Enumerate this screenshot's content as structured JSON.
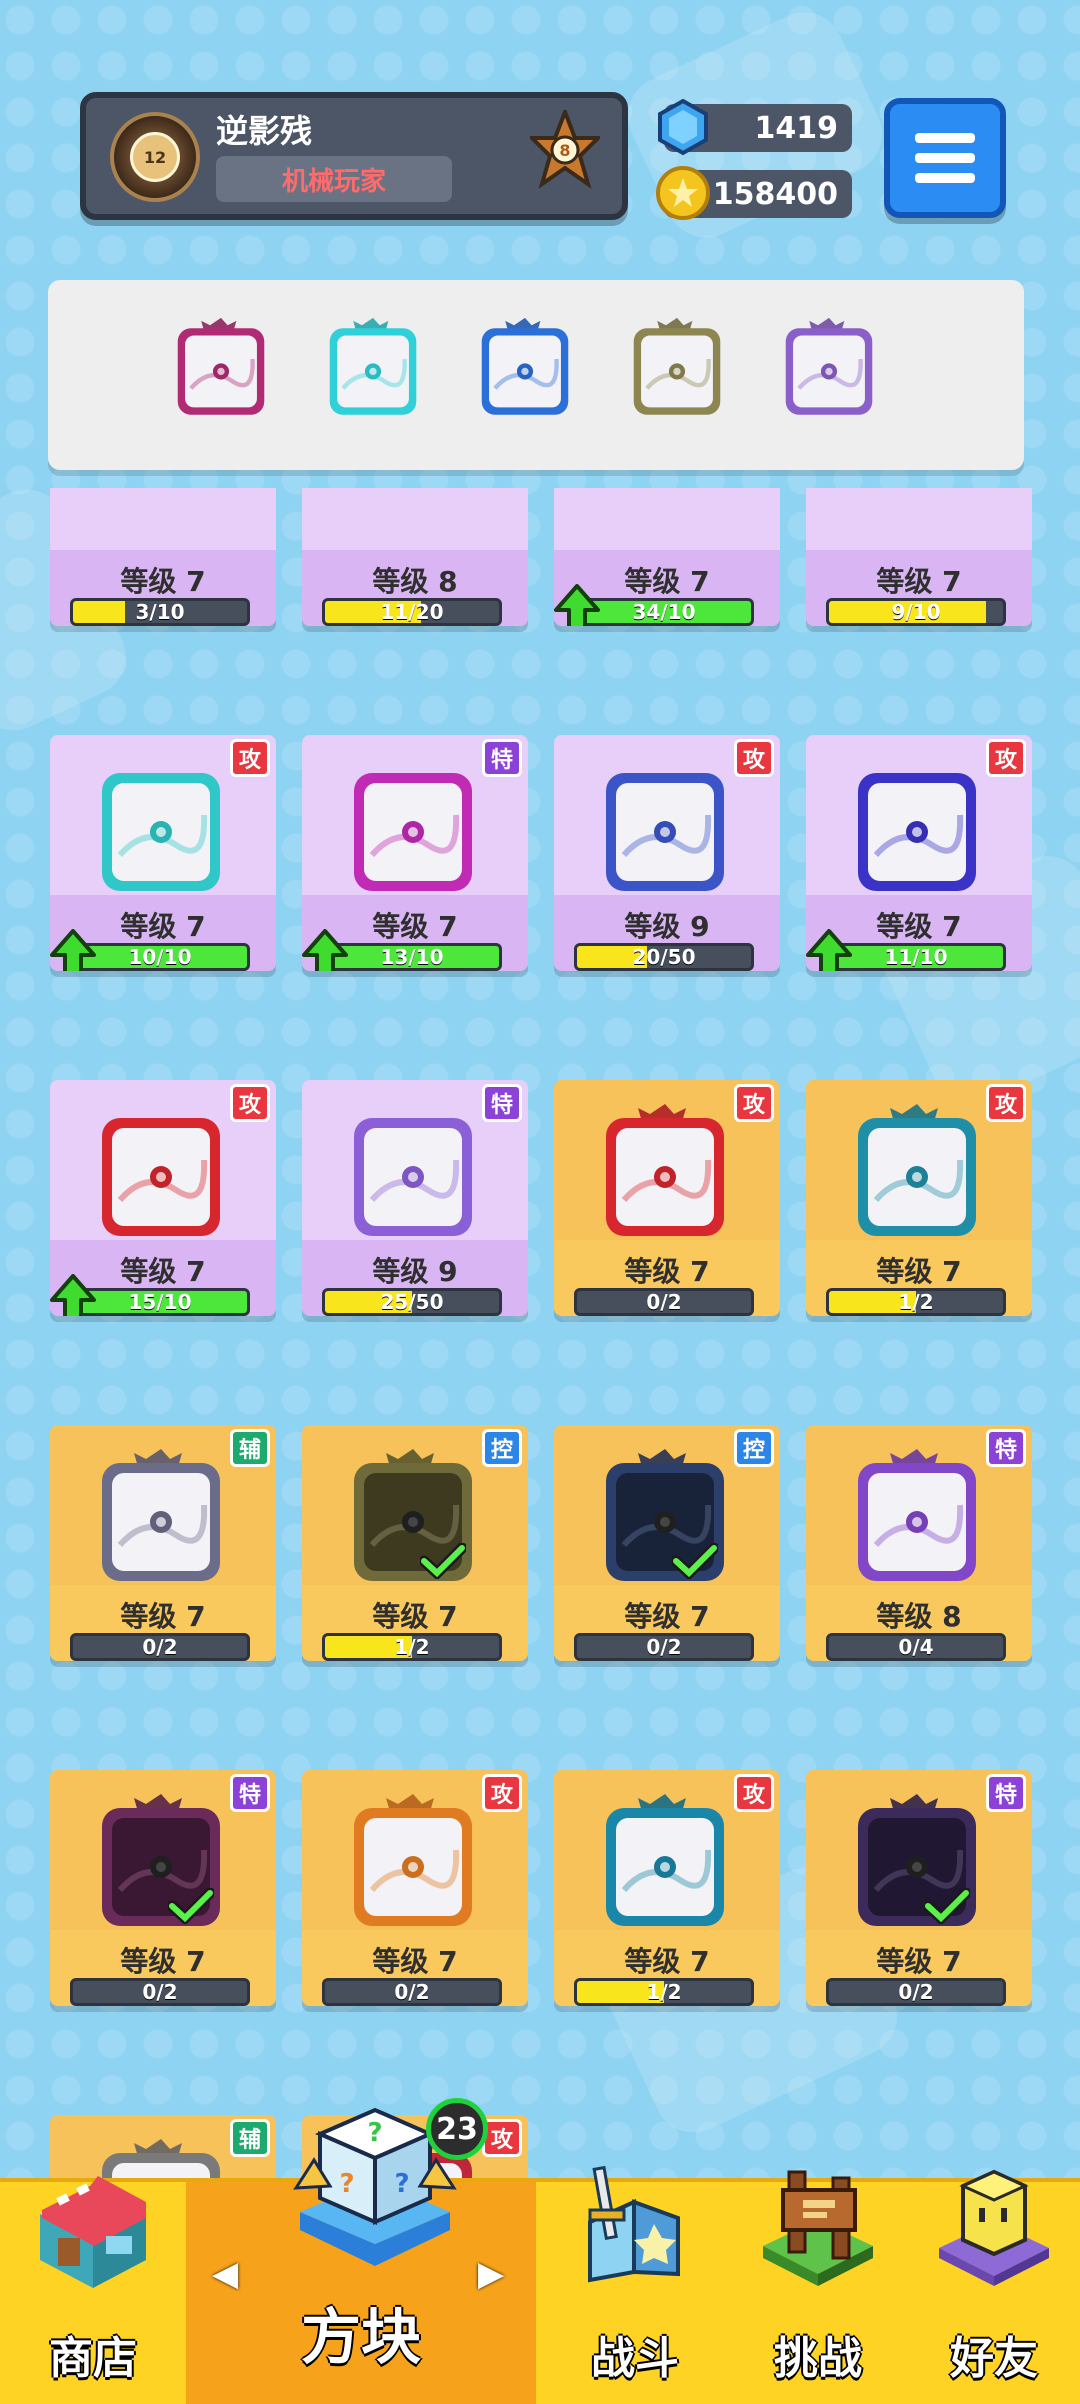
{
  "player": {
    "name": "逆影残",
    "title": "机械玩家",
    "avatar_level": "12",
    "rank": "8"
  },
  "currency": {
    "gems": "1419",
    "coins": "158400"
  },
  "colors": {
    "background": "#8fd3f2",
    "card_purple": "#e3c8f7",
    "card_gold": "#f7c25a",
    "nav_bar": "#ffd324",
    "nav_active": "#f7a21b",
    "progress_yellow": "#f8e51b",
    "progress_green": "#4de73b",
    "badge_attack": "#e8373f",
    "badge_special": "#8c42d6",
    "badge_support": "#1eaa6e",
    "badge_control": "#2b86e8",
    "menu_button": "#2b8cf4"
  },
  "deck": [
    {
      "icon": "crossbow-dice-icon",
      "color": "#b02b73"
    },
    {
      "icon": "wind-dice-icon",
      "color": "#2fd0d8"
    },
    {
      "icon": "ice-dice-icon",
      "color": "#2b6fd8"
    },
    {
      "icon": "shield-dice-icon",
      "color": "#8d8650"
    },
    {
      "icon": "void-dice-icon",
      "color": "#8b5fc9"
    }
  ],
  "cards": [
    {
      "tier": "purple",
      "level": "等级 7",
      "progress": "3/10",
      "ratio": 0.3,
      "upgradable": false,
      "badge": "",
      "icon": "card-icon"
    },
    {
      "tier": "purple",
      "level": "等级 8",
      "progress": "11/20",
      "ratio": 0.55,
      "upgradable": false,
      "badge": "",
      "icon": "card-icon"
    },
    {
      "tier": "purple",
      "level": "等级 7",
      "progress": "34/10",
      "ratio": 1.0,
      "upgradable": true,
      "badge": "",
      "icon": "card-icon"
    },
    {
      "tier": "purple",
      "level": "等级 7",
      "progress": "9/10",
      "ratio": 0.9,
      "upgradable": false,
      "badge": "",
      "icon": "card-icon"
    },
    {
      "tier": "purple",
      "level": "等级 7",
      "progress": "10/10",
      "ratio": 1.0,
      "upgradable": true,
      "badge": "攻",
      "badge_type": "atk",
      "icon": "wind-dice-icon",
      "color": "#2fc7c7"
    },
    {
      "tier": "purple",
      "level": "等级 7",
      "progress": "13/10",
      "ratio": 1.0,
      "upgradable": true,
      "badge": "特",
      "badge_type": "spec",
      "icon": "switch-dice-icon",
      "color": "#c02ab5"
    },
    {
      "tier": "purple",
      "level": "等级 9",
      "progress": "20/50",
      "ratio": 0.4,
      "upgradable": false,
      "badge": "攻",
      "badge_type": "atk",
      "icon": "gear-dice-icon",
      "color": "#3b55c8"
    },
    {
      "tier": "purple",
      "level": "等级 7",
      "progress": "11/10",
      "ratio": 1.0,
      "upgradable": true,
      "badge": "攻",
      "badge_type": "atk",
      "icon": "energy-dice-icon",
      "color": "#3b32c8"
    },
    {
      "tier": "purple",
      "level": "等级 7",
      "progress": "15/10",
      "ratio": 1.0,
      "upgradable": true,
      "badge": "攻",
      "badge_type": "atk",
      "icon": "fire-dice-icon",
      "color": "#d8262f"
    },
    {
      "tier": "purple",
      "level": "等级 9",
      "progress": "25/50",
      "ratio": 0.5,
      "upgradable": false,
      "badge": "特",
      "badge_type": "spec",
      "icon": "lightning-dice-icon",
      "color": "#8b5fd6"
    },
    {
      "tier": "gold",
      "level": "等级 7",
      "progress": "0/2",
      "ratio": 0.0,
      "upgradable": false,
      "badge": "攻",
      "badge_type": "atk",
      "icon": "star-burst-dice-icon",
      "color": "#d8262f",
      "dragon": true
    },
    {
      "tier": "gold",
      "level": "等级 7",
      "progress": "1/2",
      "ratio": 0.5,
      "upgradable": false,
      "badge": "攻",
      "badge_type": "atk",
      "icon": "wind-dragon-dice-icon",
      "color": "#1f8fa8",
      "dragon": true
    },
    {
      "tier": "gold",
      "level": "等级 7",
      "progress": "0/2",
      "ratio": 0.0,
      "upgradable": false,
      "badge": "辅",
      "badge_type": "sup",
      "icon": "shark-dice-icon",
      "color": "#6b6b8a",
      "dragon": true,
      "dark": false
    },
    {
      "tier": "gold",
      "level": "等级 7",
      "progress": "1/2",
      "ratio": 0.5,
      "upgradable": false,
      "badge": "控",
      "badge_type": "ctrl",
      "icon": "shield-dragon-dice-icon",
      "color": "#6f6a3a",
      "dragon": true,
      "dark": true,
      "equipped": true
    },
    {
      "tier": "gold",
      "level": "等级 7",
      "progress": "0/2",
      "ratio": 0.0,
      "upgradable": false,
      "badge": "控",
      "badge_type": "ctrl",
      "icon": "ice-dragon-dice-icon",
      "color": "#2c3f6a",
      "dragon": true,
      "dark": true,
      "equipped": true
    },
    {
      "tier": "gold",
      "level": "等级 8",
      "progress": "0/4",
      "ratio": 0.0,
      "upgradable": false,
      "badge": "特",
      "badge_type": "spec",
      "icon": "void-dragon-dice-icon",
      "color": "#8246c9",
      "dragon": true
    },
    {
      "tier": "gold",
      "level": "等级 7",
      "progress": "0/2",
      "ratio": 0.0,
      "upgradable": false,
      "badge": "特",
      "badge_type": "spec",
      "icon": "crossbow-dragon-dice-icon",
      "color": "#6a2a5a",
      "dragon": true,
      "dark": true,
      "equipped": true
    },
    {
      "tier": "gold",
      "level": "等级 7",
      "progress": "0/2",
      "ratio": 0.0,
      "upgradable": false,
      "badge": "攻",
      "badge_type": "atk",
      "icon": "gun-dragon-dice-icon",
      "color": "#e07b22",
      "dragon": true
    },
    {
      "tier": "gold",
      "level": "等级 7",
      "progress": "1/2",
      "ratio": 0.5,
      "upgradable": false,
      "badge": "攻",
      "badge_type": "atk",
      "icon": "vortex-dragon-dice-icon",
      "color": "#1a86a8",
      "dragon": true
    },
    {
      "tier": "gold",
      "level": "等级 7",
      "progress": "0/2",
      "ratio": 0.0,
      "upgradable": false,
      "badge": "特",
      "badge_type": "spec",
      "icon": "void-dark-dragon-dice-icon",
      "color": "#3b2a5a",
      "dragon": true,
      "dark": true,
      "equipped": true
    },
    {
      "tier": "gold",
      "level": "",
      "progress": "",
      "ratio": 0.0,
      "upgradable": false,
      "badge": "辅",
      "badge_type": "sup",
      "icon": "clock-dragon-dice-icon",
      "color": "#7a7a7a",
      "dragon": true
    },
    {
      "tier": "gold",
      "level": "",
      "progress": "",
      "ratio": 0.0,
      "upgradable": false,
      "badge": "攻",
      "badge_type": "atk",
      "icon": "saw-dragon-dice-icon",
      "color": "#c0263a",
      "dragon": true
    }
  ],
  "nav": {
    "shop": "商店",
    "dice": "方块",
    "battle": "战斗",
    "challenge": "挑战",
    "friends": "好友",
    "dice_count": "23"
  }
}
